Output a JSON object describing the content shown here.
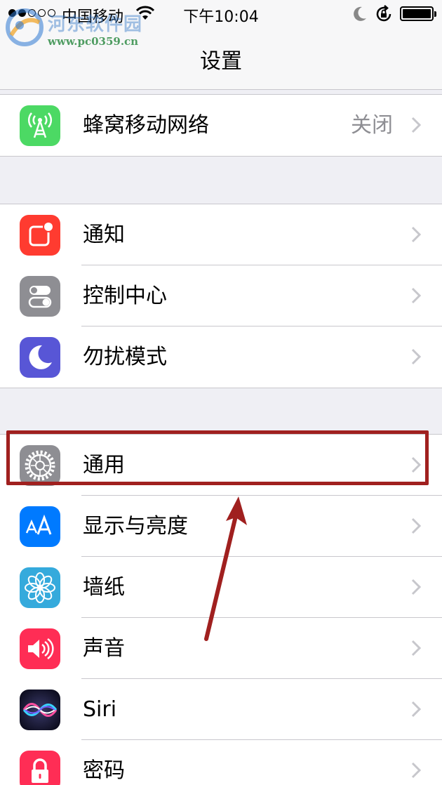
{
  "status_bar": {
    "carrier": "中国移动",
    "time": "下午10:04"
  },
  "watermark": {
    "title": "河东软件园",
    "url": "www.pc0359.cn"
  },
  "nav": {
    "title": "设置"
  },
  "groups": [
    {
      "items": [
        {
          "label": "蜂窝移动网络",
          "detail": "关闭",
          "icon": "cellular-antenna-icon",
          "color": "#4cd964"
        }
      ]
    },
    {
      "items": [
        {
          "label": "通知",
          "icon": "notifications-icon",
          "color": "#ff3b30"
        },
        {
          "label": "控制中心",
          "icon": "control-center-icon",
          "color": "#8e8e93"
        },
        {
          "label": "勿扰模式",
          "icon": "moon-icon",
          "color": "#5856d6"
        }
      ]
    },
    {
      "items": [
        {
          "label": "通用",
          "icon": "gear-icon",
          "color": "#8e8e93"
        },
        {
          "label": "显示与亮度",
          "icon": "text-size-icon",
          "color": "#007aff"
        },
        {
          "label": "墙纸",
          "icon": "flower-icon",
          "color": "#35aadc"
        },
        {
          "label": "声音",
          "icon": "speaker-icon",
          "color": "#ff2d55"
        },
        {
          "label": "Siri",
          "icon": "siri-icon",
          "color": "#1a1a3a"
        },
        {
          "label": "密码",
          "icon": "lock-icon",
          "color": "#ff2d55"
        }
      ]
    }
  ],
  "annotation": {
    "highlighted_item": "通用",
    "color": "#a0201f"
  }
}
